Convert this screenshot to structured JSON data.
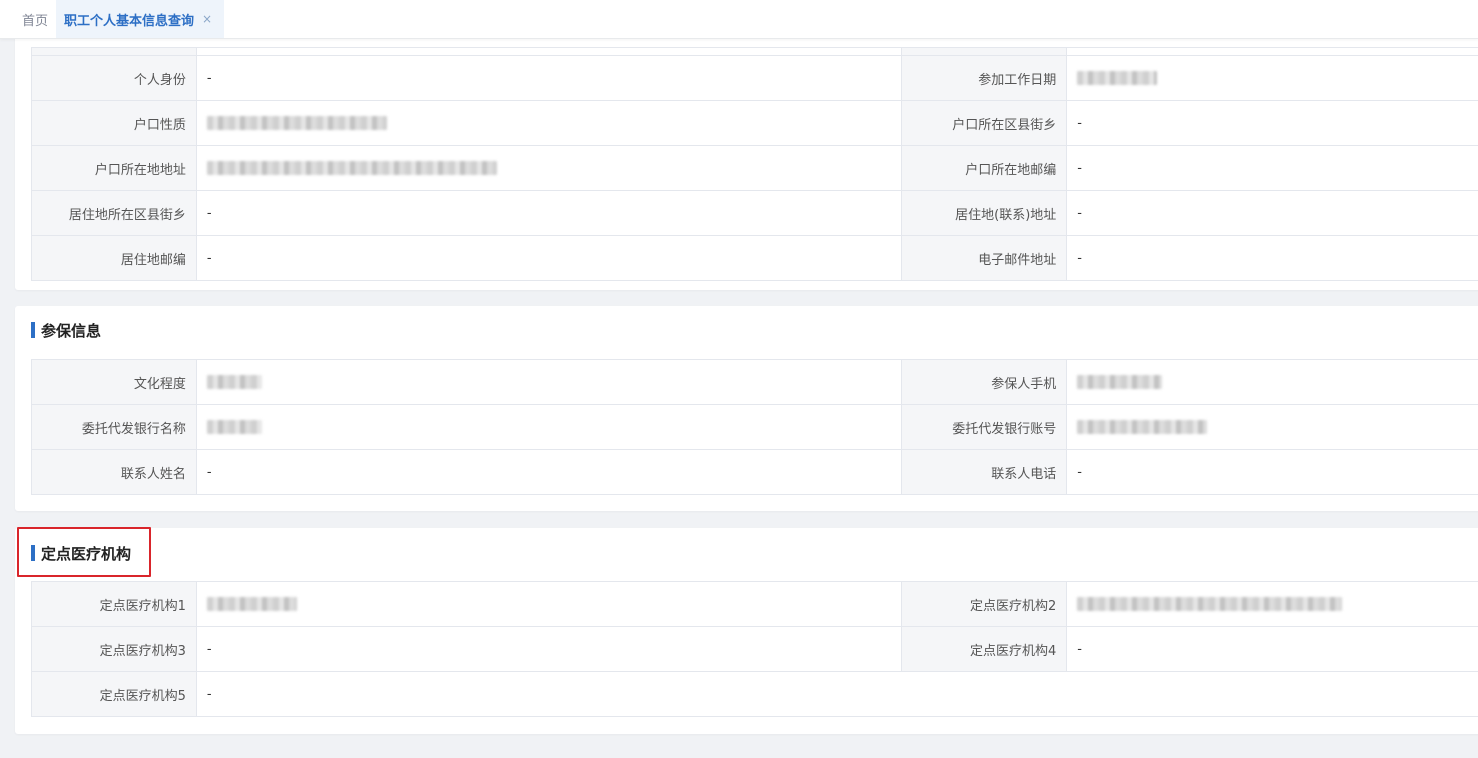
{
  "tabs": {
    "home": "首页",
    "active": "职工个人基本信息查询",
    "close": "×"
  },
  "basic": {
    "rows": [
      {
        "l1": "个人身份",
        "v1": "-",
        "l2": "参加工作日期",
        "v2": ""
      },
      {
        "l1": "户口性质",
        "v1": "",
        "l2": "户口所在区县街乡",
        "v2": "-"
      },
      {
        "l1": "户口所在地地址",
        "v1": "",
        "l2": "户口所在地邮编",
        "v2": "-"
      },
      {
        "l1": "居住地所在区县街乡",
        "v1": "-",
        "l2": "居住地(联系)地址",
        "v2": "-"
      },
      {
        "l1": "居住地邮编",
        "v1": "-",
        "l2": "电子邮件地址",
        "v2": "-"
      }
    ]
  },
  "insurance": {
    "title": "参保信息",
    "rows": [
      {
        "l1": "文化程度",
        "v1": "",
        "l2": "参保人手机",
        "v2": ""
      },
      {
        "l1": "委托代发银行名称",
        "v1": "",
        "l2": "委托代发银行账号",
        "v2": ""
      },
      {
        "l1": "联系人姓名",
        "v1": "-",
        "l2": "联系人电话",
        "v2": "-"
      }
    ]
  },
  "medical": {
    "title": "定点医疗机构",
    "rows": [
      {
        "l1": "定点医疗机构1",
        "v1": "",
        "l2": "定点医疗机构2",
        "v2": ""
      },
      {
        "l1": "定点医疗机构3",
        "v1": "-",
        "l2": "定点医疗机构4",
        "v2": "-"
      },
      {
        "l1": "定点医疗机构5",
        "v1": "-"
      }
    ]
  }
}
